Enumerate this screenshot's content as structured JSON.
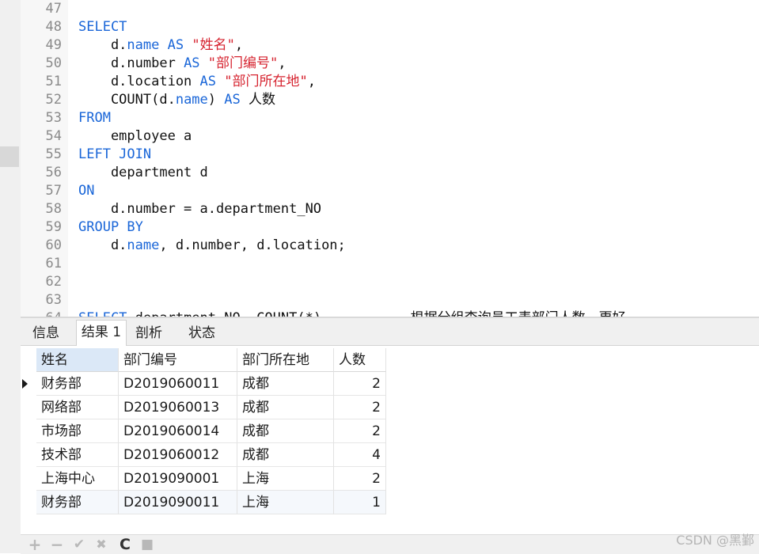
{
  "editor": {
    "lines": [
      {
        "n": "47",
        "tokens": []
      },
      {
        "n": "48",
        "tokens": [
          {
            "t": "SELECT",
            "c": "kw"
          }
        ]
      },
      {
        "n": "49",
        "tokens": [
          {
            "t": "    d.",
            "c": ""
          },
          {
            "t": "name",
            "c": "kw"
          },
          {
            "t": " ",
            "c": ""
          },
          {
            "t": "AS",
            "c": "kw"
          },
          {
            "t": " ",
            "c": ""
          },
          {
            "t": "\"姓名\"",
            "c": "str"
          },
          {
            "t": ",",
            "c": ""
          }
        ]
      },
      {
        "n": "50",
        "tokens": [
          {
            "t": "    d.number ",
            "c": ""
          },
          {
            "t": "AS",
            "c": "kw"
          },
          {
            "t": " ",
            "c": ""
          },
          {
            "t": "\"部门编号\"",
            "c": "str"
          },
          {
            "t": ",",
            "c": ""
          }
        ]
      },
      {
        "n": "51",
        "tokens": [
          {
            "t": "    d.location ",
            "c": ""
          },
          {
            "t": "AS",
            "c": "kw"
          },
          {
            "t": " ",
            "c": ""
          },
          {
            "t": "\"部门所在地\"",
            "c": "str"
          },
          {
            "t": ",",
            "c": ""
          }
        ]
      },
      {
        "n": "52",
        "tokens": [
          {
            "t": "    COUNT(d.",
            "c": ""
          },
          {
            "t": "name",
            "c": "kw"
          },
          {
            "t": ") ",
            "c": ""
          },
          {
            "t": "AS",
            "c": "kw"
          },
          {
            "t": " 人数",
            "c": ""
          }
        ]
      },
      {
        "n": "53",
        "tokens": [
          {
            "t": "FROM",
            "c": "kw"
          }
        ]
      },
      {
        "n": "54",
        "tokens": [
          {
            "t": "    employee a",
            "c": ""
          }
        ]
      },
      {
        "n": "55",
        "tokens": [
          {
            "t": "LEFT JOIN",
            "c": "kw"
          }
        ]
      },
      {
        "n": "56",
        "tokens": [
          {
            "t": "    department d",
            "c": ""
          }
        ]
      },
      {
        "n": "57",
        "tokens": [
          {
            "t": "ON",
            "c": "kw"
          }
        ]
      },
      {
        "n": "58",
        "tokens": [
          {
            "t": "    d.number = a.department_NO",
            "c": ""
          }
        ]
      },
      {
        "n": "59",
        "tokens": [
          {
            "t": "GROUP BY",
            "c": "kw"
          }
        ]
      },
      {
        "n": "60",
        "tokens": [
          {
            "t": "    d.",
            "c": ""
          },
          {
            "t": "name",
            "c": "kw"
          },
          {
            "t": ", d.number, d.location;",
            "c": ""
          }
        ]
      },
      {
        "n": "61",
        "tokens": []
      },
      {
        "n": "62",
        "tokens": []
      },
      {
        "n": "63",
        "tokens": []
      },
      {
        "n": "64",
        "tokens": [
          {
            "t": "SELECT",
            "c": "kw"
          },
          {
            "t": " department_NO, COUNT(*)        -- 根据分组查询员工表部门人数，更好",
            "c": ""
          }
        ]
      }
    ]
  },
  "tabs": [
    {
      "label": "信息"
    },
    {
      "label": "结果 1"
    },
    {
      "label": "剖析"
    },
    {
      "label": "状态"
    }
  ],
  "grid": {
    "columns": [
      "姓名",
      "部门编号",
      "部门所在地",
      "人数"
    ],
    "rows": [
      [
        "财务部",
        "D2019060011",
        "成都",
        "2"
      ],
      [
        "网络部",
        "D2019060013",
        "成都",
        "2"
      ],
      [
        "市场部",
        "D2019060014",
        "成都",
        "2"
      ],
      [
        "技术部",
        "D2019060012",
        "成都",
        "4"
      ],
      [
        "上海中心",
        "D2019090001",
        "上海",
        "2"
      ],
      [
        "财务部",
        "D2019090011",
        "上海",
        "1"
      ]
    ]
  },
  "toolbar": {
    "add": "+",
    "remove": "−",
    "apply": "✔",
    "cancel": "✖",
    "refresh": "C",
    "stop": "■"
  },
  "watermark": "CSDN @黑鄞",
  "colors": {
    "keyword": "#1a66d8",
    "string": "#d6232f",
    "header_selected": "#dbe8f7"
  }
}
